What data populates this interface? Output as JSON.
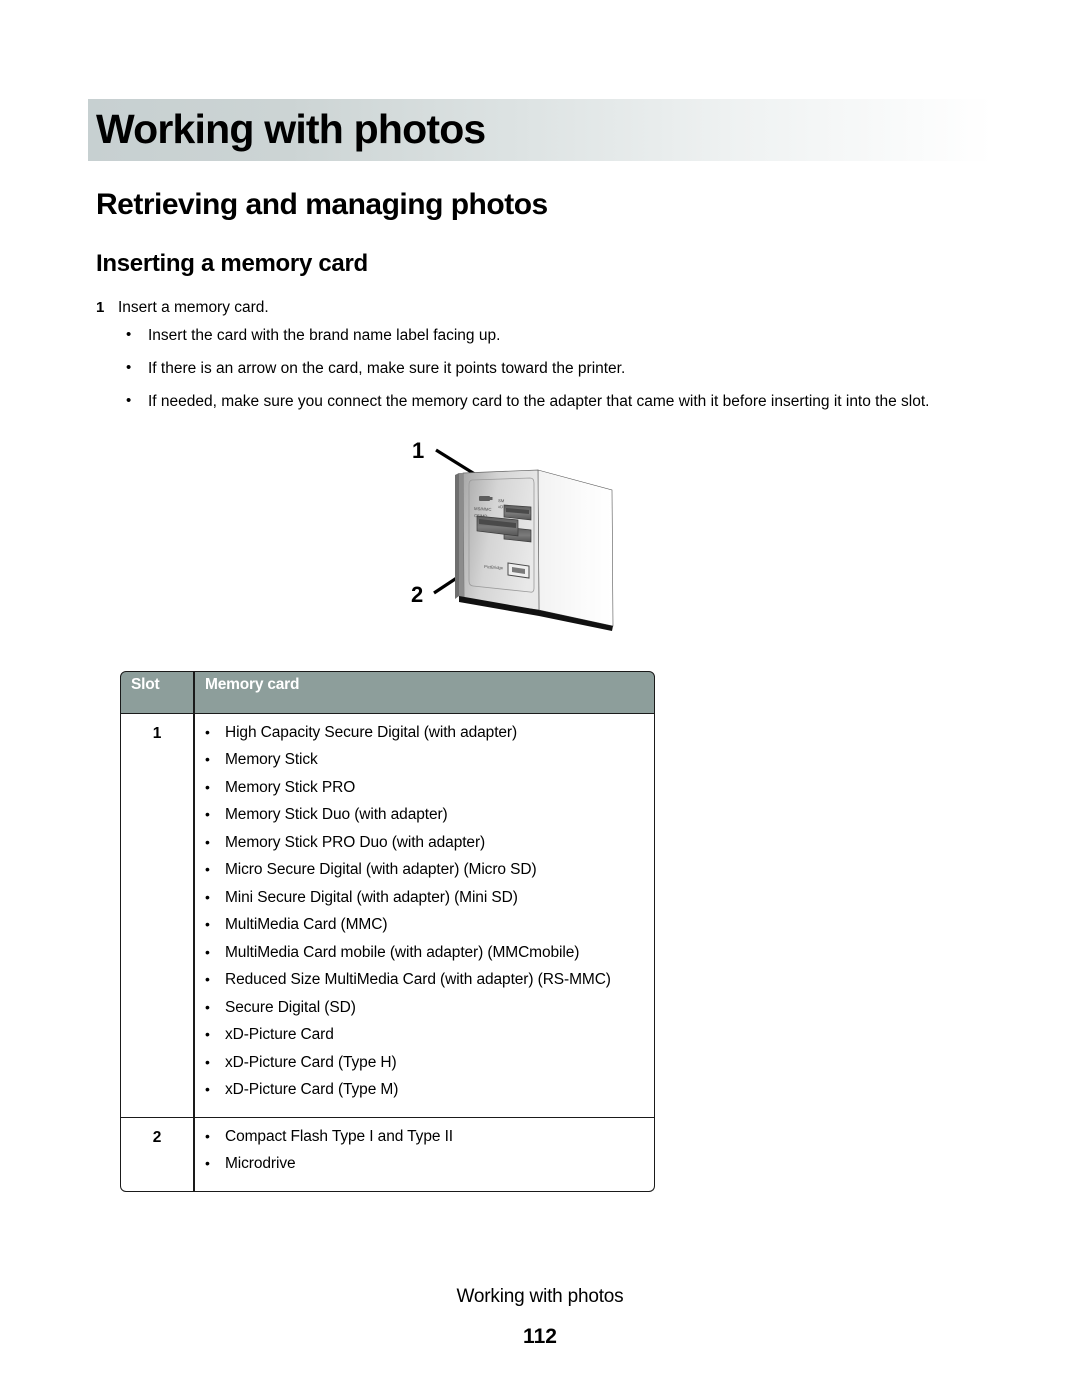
{
  "document": {
    "chapter_banner": "Working with photos",
    "section_heading": "Retrieving and managing photos",
    "subsection_heading": "Inserting a memory card"
  },
  "procedure": {
    "step_number": "1",
    "step_text": "Insert a memory card.",
    "bullets": [
      "Insert the card with the brand name label facing up.",
      "If there is an arrow on the card, make sure it points toward the printer.",
      "If needed, make sure you connect the memory card to the adapter that came with it before inserting it into the slot."
    ]
  },
  "illustration": {
    "name": "printer-memory-card-slots",
    "callout_1": "1",
    "callout_2": "2",
    "slot_labels": [
      "MS/MMC",
      "CF/MD",
      "PictBridge",
      "SM/xD"
    ]
  },
  "table": {
    "headers": [
      "Slot",
      "Memory card"
    ],
    "rows": [
      {
        "slot": "1",
        "cards": [
          "High Capacity Secure Digital (with adapter)",
          "Memory Stick",
          "Memory Stick PRO",
          "Memory Stick Duo (with adapter)",
          "Memory Stick PRO Duo (with adapter)",
          "Micro Secure Digital (with adapter) (Micro SD)",
          "Mini Secure Digital (with adapter) (Mini SD)",
          "MultiMedia Card (MMC)",
          "MultiMedia Card mobile (with adapter) (MMCmobile)",
          "Reduced Size MultiMedia Card (with adapter) (RS-MMC)",
          "Secure Digital (SD)",
          "xD-Picture Card",
          "xD-Picture Card (Type H)",
          "xD-Picture Card (Type M)"
        ]
      },
      {
        "slot": "2",
        "cards": [
          "Compact Flash Type I and Type II",
          "Microdrive"
        ]
      }
    ]
  },
  "footer": {
    "title": "Working with photos",
    "page_number": "112"
  },
  "colors": {
    "banner_start": "#c7d0d1",
    "banner_end": "#ffffff",
    "table_header_bg": "#8d9e9b",
    "table_header_text": "#ffffff",
    "border": "#1a1a1a",
    "text": "#000000"
  },
  "glyphs": {
    "bullet": "•"
  }
}
